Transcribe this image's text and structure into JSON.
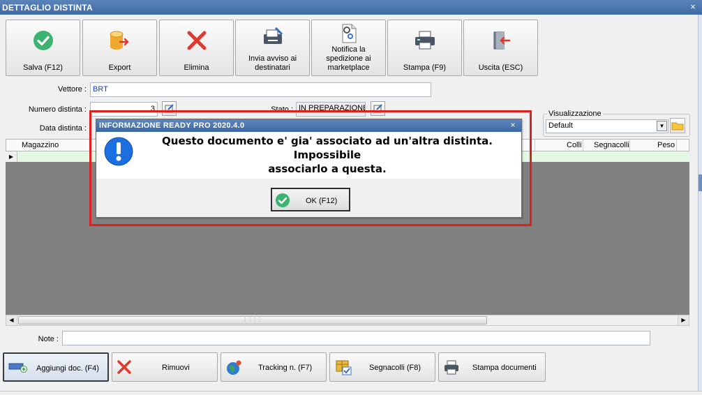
{
  "window": {
    "title": "DETTAGLIO DISTINTA",
    "close_glyph": "×"
  },
  "toolbar": {
    "buttons": [
      {
        "label": "Salva (F12)",
        "icon": "check-circle-icon"
      },
      {
        "label": "Export",
        "icon": "database-export-icon"
      },
      {
        "label": "Elimina",
        "icon": "red-x-icon"
      },
      {
        "label": "Invia avviso ai destinatari",
        "icon": "printer-pen-icon"
      },
      {
        "label": "Notifica la spedizione ai marketplace",
        "icon": "document-gear-icon"
      },
      {
        "label": "Stampa (F9)",
        "icon": "printer-icon"
      },
      {
        "label": "Uscita (ESC)",
        "icon": "exit-door-icon"
      }
    ]
  },
  "form": {
    "vettore_label": "Vettore :",
    "vettore_value": "BRT",
    "numero_label": "Numero distinta :",
    "numero_value": "3",
    "stato_label": "Stato :",
    "stato_value": "IN PREPARAZIONE",
    "data_label": "Data distinta :",
    "note_label": "Note :",
    "note_value": ""
  },
  "visualizzazione": {
    "label": "Visualizzazione",
    "selected": "Default"
  },
  "grid": {
    "columns": [
      "Magazzino",
      "Colli",
      "Segnacolli",
      "Peso"
    ],
    "row_indicator": "▶"
  },
  "bottom_buttons": [
    {
      "label": "Aggiungi doc. (F4)",
      "icon": "add-document-icon"
    },
    {
      "label": "Rimuovi",
      "icon": "red-x-icon"
    },
    {
      "label": "Tracking n. (F7)",
      "icon": "globe-icon"
    },
    {
      "label": "Segnacolli (F8)",
      "icon": "package-check-icon"
    },
    {
      "label": "Stampa documenti",
      "icon": "printer-icon"
    }
  ],
  "dialog": {
    "title": "INFORMAZIONE READY PRO 2020.4.0",
    "close_glyph": "×",
    "message_line1": "Questo documento e' gia' associato ad un'altra distinta. Impossibile",
    "message_line2": "associarlo a questa.",
    "ok_label": "OK (F12)",
    "icon": "info-exclamation-icon"
  },
  "colors": {
    "accent": "#3d6aa6",
    "highlight": "#e01e1e",
    "grid_row": "#e2f8e2",
    "grid_body": "#808080"
  }
}
